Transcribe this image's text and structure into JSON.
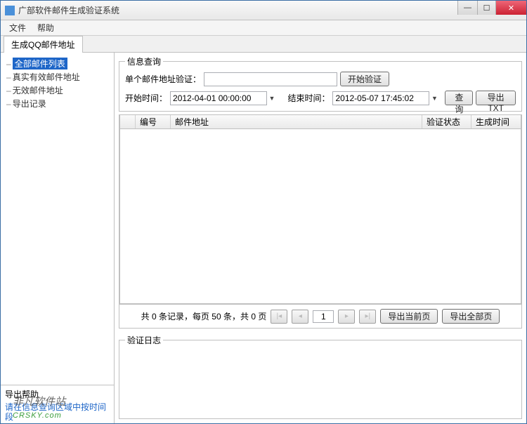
{
  "window": {
    "title": "广部软件邮件生成验证系统"
  },
  "menu": {
    "file": "文件",
    "help": "帮助"
  },
  "tabs": {
    "main": "生成QQ邮件地址"
  },
  "sidebar": {
    "items": [
      {
        "label": "全部邮件列表"
      },
      {
        "label": "真实有效邮件地址"
      },
      {
        "label": "无效邮件地址"
      },
      {
        "label": "导出记录"
      }
    ],
    "exportHelp": {
      "header": "导出帮助",
      "text": "请在信息查询区域中按时间段"
    }
  },
  "query": {
    "legend": "信息查询",
    "singleLabel": "单个邮件地址验证：",
    "startVerifyBtn": "开始验证",
    "startTimeLabel": "开始时间：",
    "startTimeValue": "2012-04-01 00:00:00",
    "endTimeLabel": "结束时间：",
    "endTimeValue": "2012-05-07 17:45:02",
    "queryBtn": "查询",
    "exportTxtBtn": "导出TXT"
  },
  "grid": {
    "columns": {
      "num": "编号",
      "email": "邮件地址",
      "status": "验证状态",
      "time": "生成时间"
    }
  },
  "pager": {
    "info": "共 0 条记录，每页 50 条，共 0 页",
    "page": "1",
    "exportCurrentBtn": "导出当前页",
    "exportAllBtn": "导出全部页"
  },
  "log": {
    "legend": "验证日志"
  },
  "watermark": {
    "cn": "非凡软件站",
    "en": "CRSKY.com"
  }
}
